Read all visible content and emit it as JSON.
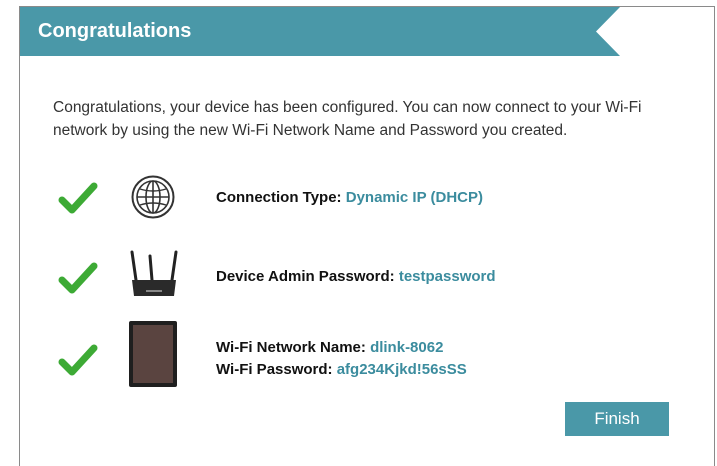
{
  "header": {
    "title": "Congratulations"
  },
  "intro": "Congratulations, your device has been configured. You can now connect to your Wi-Fi network by using the new Wi-Fi Network Name and Password you created.",
  "rows": [
    {
      "label": "Connection Type:",
      "value": "Dynamic IP (DHCP)",
      "icon": "globe-icon"
    },
    {
      "label": "Device Admin Password:",
      "value": "testpassword",
      "icon": "router-icon"
    },
    {
      "label": "Wi-Fi Network Name:",
      "value": "dlink-8062",
      "label2": "Wi-Fi Password:",
      "value2": "afg234Kjkd!56sSS",
      "icon": "tablet-icon"
    }
  ],
  "finish_label": "Finish",
  "colors": {
    "accent": "#4a98a8",
    "value_text": "#3b8c9e",
    "check": "#3daa35"
  }
}
